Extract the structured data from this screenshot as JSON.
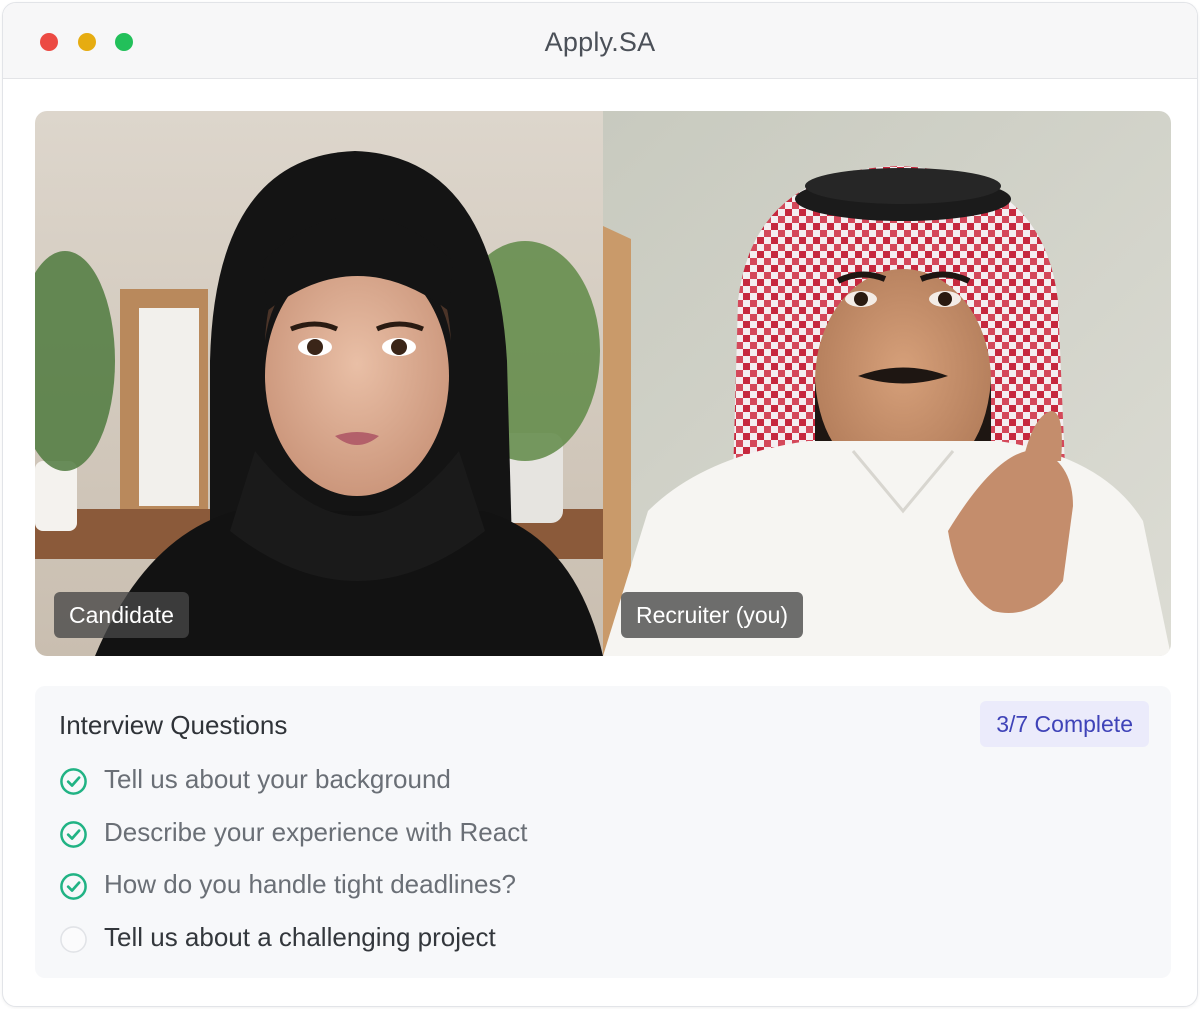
{
  "colors": {
    "close": "#ec4a43",
    "minimize": "#e6ac11",
    "maximize": "#22c05a",
    "check": "#21b384",
    "badge_text": "#3f43b8",
    "badge_bg": "#ebebfb"
  },
  "window": {
    "title": "Apply.SA",
    "controls": [
      "close",
      "minimize",
      "maximize"
    ]
  },
  "video": {
    "left": {
      "label": "Candidate"
    },
    "right": {
      "label": "Recruiter (you)"
    }
  },
  "questions": {
    "title": "Interview Questions",
    "progress_label": "3/7 Complete",
    "completed": 3,
    "total": 7,
    "items": [
      {
        "text": "Tell us about your background",
        "status": "complete",
        "icon": "check-circle-icon"
      },
      {
        "text": "Describe your experience with React",
        "status": "complete",
        "icon": "check-circle-icon"
      },
      {
        "text": "How do you handle tight deadlines?",
        "status": "complete",
        "icon": "check-circle-icon"
      },
      {
        "text": "Tell us about a challenging project",
        "status": "pending",
        "icon": "empty-circle-icon"
      }
    ]
  }
}
